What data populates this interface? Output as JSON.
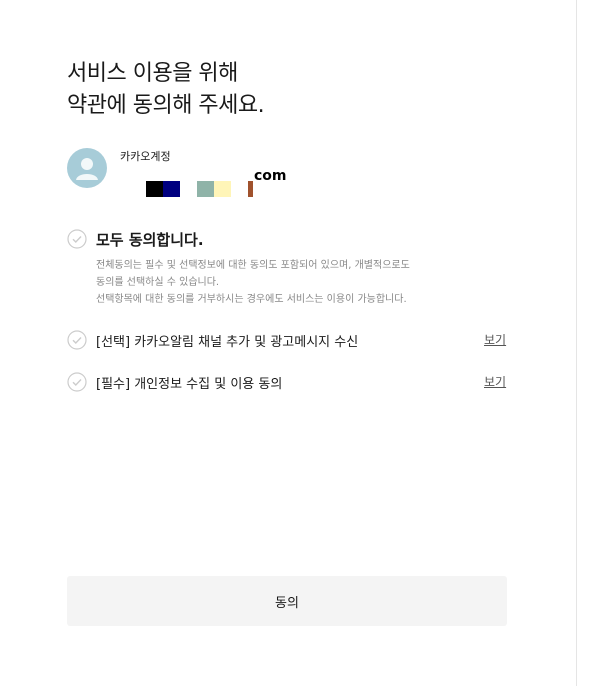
{
  "header": {
    "title_line1": "서비스 이용을 위해",
    "title_line2": "약관에 동의해 주세요."
  },
  "account": {
    "label": "카카오계정",
    "email_suffix": "com",
    "avatar_icon": "user-avatar-icon",
    "avatar_color": "#a7ccd8"
  },
  "consent": {
    "all_label": "모두 동의합니다.",
    "description_lines": [
      "전체동의는 필수 및 선택정보에 대한 동의도 포함되어 있으며, 개별적으로도",
      "동의를 선택하실 수 있습니다.",
      "선택항목에 대한 동의를 거부하시는 경우에도 서비스는 이용이 가능합니다."
    ],
    "terms": [
      {
        "label": "[선택] 카카오알림 채널 추가 및 광고메시지 수신",
        "view_label": "보기",
        "checked": false
      },
      {
        "label": "[필수] 개인정보 수집 및 이용 동의",
        "view_label": "보기",
        "checked": false
      }
    ],
    "check_icon": "checkmark-circle-icon",
    "check_color": "#cccccc"
  },
  "footer": {
    "agree_button_label": "동의",
    "button_bg": "#f4f4f4"
  }
}
